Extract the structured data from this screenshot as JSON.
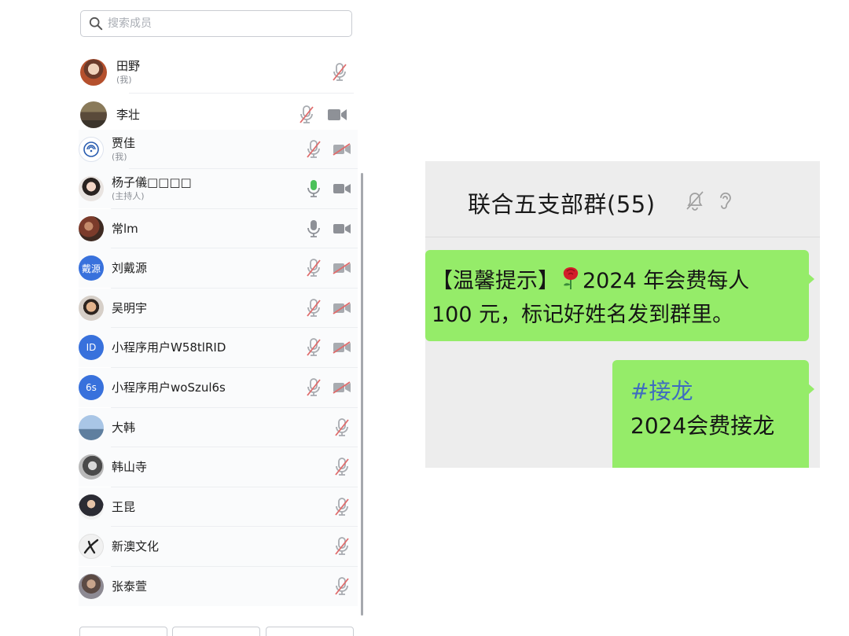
{
  "search": {
    "placeholder": "搜索成员"
  },
  "members": [
    {
      "name": "田野",
      "sub": "(我)",
      "avatar": ""
    },
    {
      "name": "李壮",
      "sub": "",
      "avatar": ""
    },
    {
      "name": "贾佳",
      "sub": "(我)",
      "avatar": ""
    },
    {
      "name": "杨子儀□□□□",
      "sub": "(主持人)",
      "avatar": ""
    },
    {
      "name": "常lm",
      "sub": "",
      "avatar": ""
    },
    {
      "name": "刘戴源",
      "sub": "",
      "avatar": "戴源"
    },
    {
      "name": "吴明宇",
      "sub": "",
      "avatar": ""
    },
    {
      "name": "小程序用户W58tlRID",
      "sub": "",
      "avatar": "ID"
    },
    {
      "name": "小程序用户woSzul6s",
      "sub": "",
      "avatar": "6s"
    },
    {
      "name": "大韩",
      "sub": "",
      "avatar": ""
    },
    {
      "name": "韩山寺",
      "sub": "",
      "avatar": ""
    },
    {
      "name": "王昆",
      "sub": "",
      "avatar": ""
    },
    {
      "name": "新澳文化",
      "sub": "",
      "avatar": ""
    },
    {
      "name": "张泰萱",
      "sub": "",
      "avatar": ""
    }
  ],
  "chat": {
    "title": "联合五支部群(55)",
    "messages": [
      {
        "line1_prefix": "【温馨提示】",
        "line1_suffix": "2024 年会费每人",
        "line2": "100 元，标记好姓名发到群里。"
      },
      {
        "line1": "#接龙",
        "line2": "2024会费接龙"
      }
    ]
  },
  "colors": {
    "bubble_green": "#95ec69",
    "chat_background": "#ededed",
    "avatar_blue": "#3871dc",
    "mic_active_green": "#4cc15a",
    "muted_red": "#e06b6b",
    "hashtag_blue": "#3f6cc0"
  },
  "icons": [
    "search-icon",
    "mic-muted-icon",
    "mic-icon",
    "mic-active-icon",
    "video-icon",
    "video-off-icon",
    "bell-off-icon",
    "ear-icon",
    "rose-emoji"
  ]
}
